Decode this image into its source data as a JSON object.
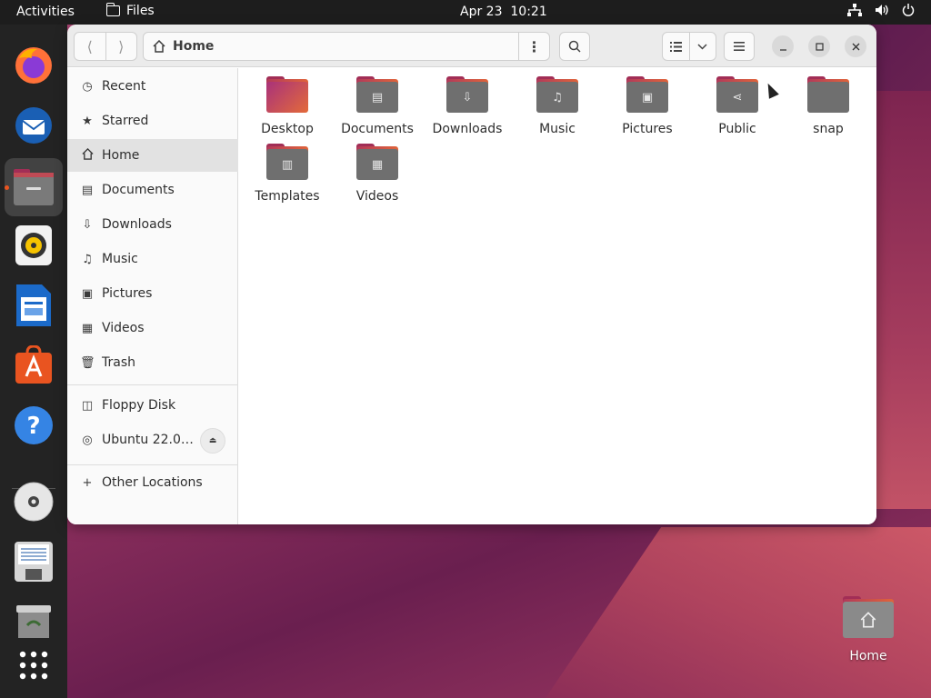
{
  "topbar": {
    "activities": "Activities",
    "app_name": "Files",
    "clock": "Apr 23  10:21",
    "tray_icons": [
      "network-icon",
      "volume-icon",
      "power-icon"
    ]
  },
  "dock": {
    "items": [
      {
        "name": "firefox",
        "icon": "firefox-icon"
      },
      {
        "name": "thunderbird",
        "icon": "thunderbird-icon"
      },
      {
        "name": "files",
        "icon": "files-icon",
        "active": true
      },
      {
        "name": "rhythmbox",
        "icon": "rhythmbox-icon"
      },
      {
        "name": "libreoffice-writer",
        "icon": "writer-icon"
      },
      {
        "name": "ubuntu-software",
        "icon": "software-icon"
      },
      {
        "name": "help",
        "icon": "help-icon"
      },
      {
        "name": "dvd-drive",
        "icon": "disc-icon"
      },
      {
        "name": "floppy",
        "icon": "floppy-icon"
      },
      {
        "name": "trash",
        "icon": "trash-icon"
      },
      {
        "name": "show-apps",
        "icon": "app-grid-icon"
      }
    ]
  },
  "window": {
    "path": "Home",
    "sidebar": {
      "places": [
        {
          "label": "Recent",
          "icon": "clock-icon"
        },
        {
          "label": "Starred",
          "icon": "star-icon"
        },
        {
          "label": "Home",
          "icon": "home-icon",
          "selected": true
        },
        {
          "label": "Documents",
          "icon": "document-icon"
        },
        {
          "label": "Downloads",
          "icon": "download-icon"
        },
        {
          "label": "Music",
          "icon": "music-icon"
        },
        {
          "label": "Pictures",
          "icon": "picture-icon"
        },
        {
          "label": "Videos",
          "icon": "video-icon"
        },
        {
          "label": "Trash",
          "icon": "trash-icon"
        }
      ],
      "devices": [
        {
          "label": "Floppy Disk",
          "icon": "floppy-icon"
        },
        {
          "label": "Ubuntu 22.0…",
          "icon": "disc-icon"
        }
      ],
      "other": {
        "label": "Other Locations",
        "icon": "plus-icon"
      }
    },
    "folders": [
      {
        "label": "Desktop",
        "emblem": ""
      },
      {
        "label": "Documents",
        "emblem": "▤"
      },
      {
        "label": "Downloads",
        "emblem": "⇩"
      },
      {
        "label": "Music",
        "emblem": "♫"
      },
      {
        "label": "Pictures",
        "emblem": "▣"
      },
      {
        "label": "Public",
        "emblem": "⋖"
      },
      {
        "label": "snap",
        "emblem": ""
      },
      {
        "label": "Templates",
        "emblem": "▥"
      },
      {
        "label": "Videos",
        "emblem": "▦"
      }
    ]
  },
  "desktop": {
    "home_icon_label": "Home"
  },
  "colors": {
    "accent": "#e95420",
    "folder_body": "#6f6f6f",
    "folder_tab": "#a22e56"
  }
}
